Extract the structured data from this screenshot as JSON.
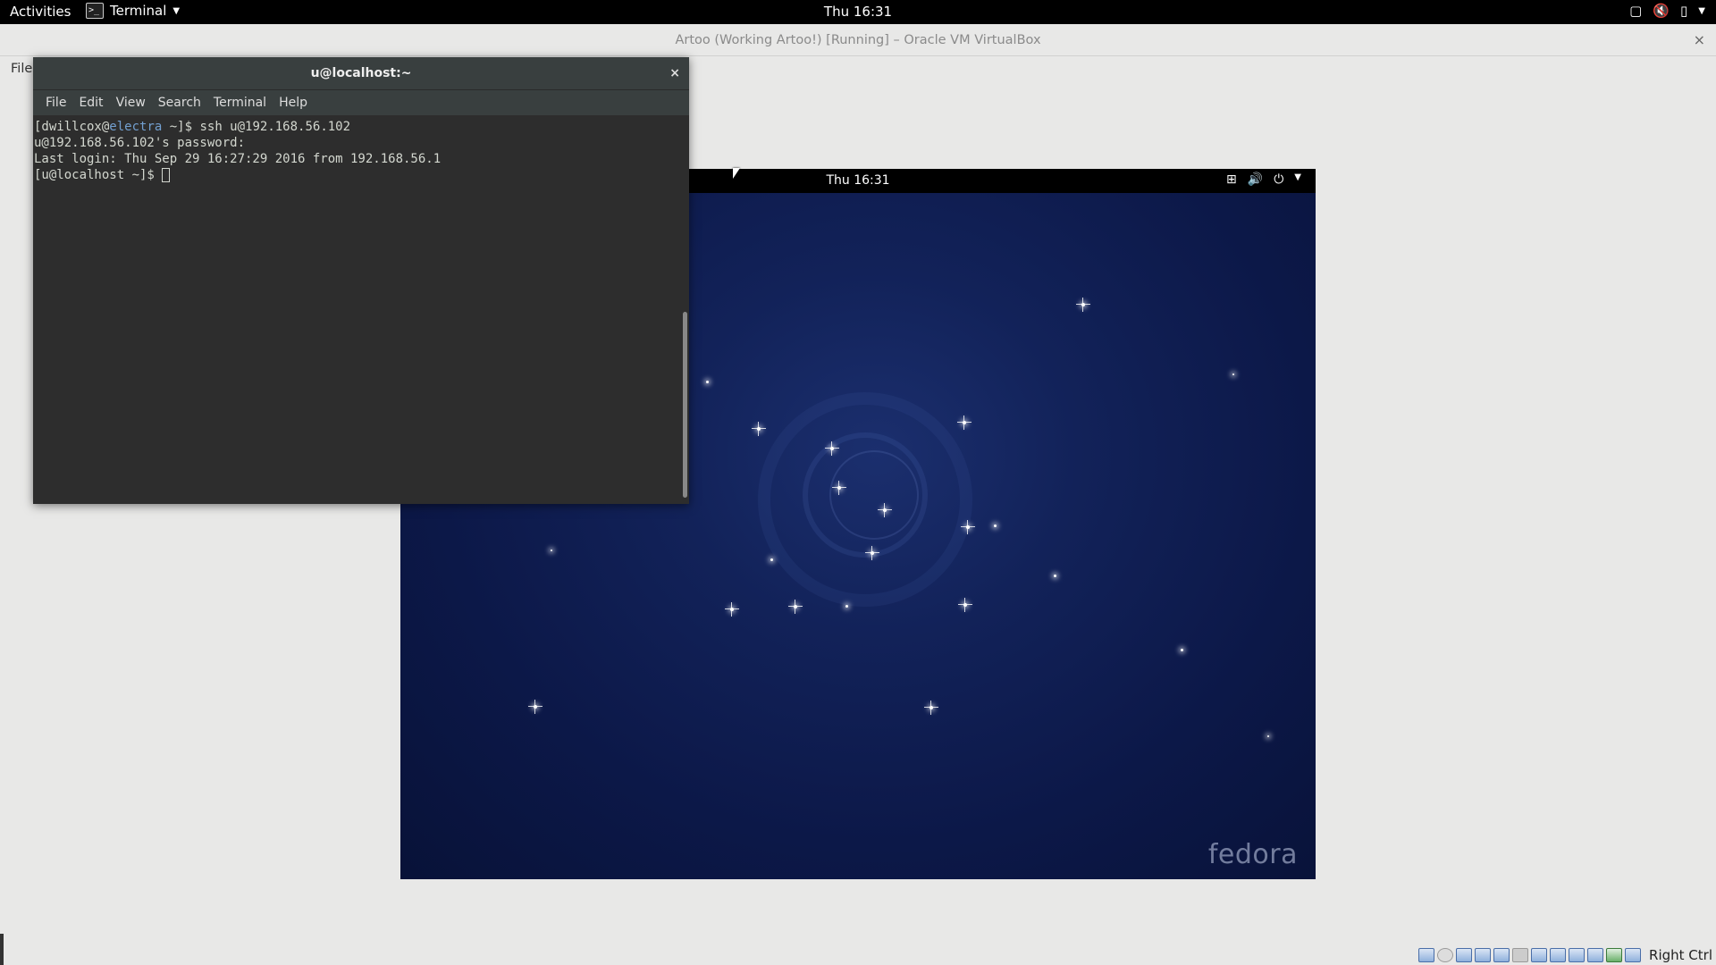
{
  "topbar": {
    "activities": "Activities",
    "app_name": "Terminal",
    "app_icon": ">_",
    "clock": "Thu 16:31",
    "tray_icons": [
      "window-icon",
      "mute-icon",
      "battery-icon",
      "chevron-down-icon"
    ]
  },
  "vbox": {
    "title": "Artoo (Working Artoo!) [Running] – Oracle VM VirtualBox",
    "close": "×",
    "menu_file": "File"
  },
  "guest": {
    "clock": "Thu 16:31",
    "tray_icons": [
      "network-icon",
      "volume-icon",
      "power-icon",
      "chevron-down-icon"
    ],
    "brand": "fedora"
  },
  "terminal": {
    "title": "u@localhost:~",
    "close": "×",
    "menu": [
      "File",
      "Edit",
      "View",
      "Search",
      "Terminal",
      "Help"
    ],
    "lines": {
      "l1_prefix": "[dwillcox@",
      "l1_host": "electra",
      "l1_suffix": " ~]$ ssh u@192.168.56.102",
      "l2": "u@192.168.56.102's password:",
      "l3": "Last login: Thu Sep 29 16:27:29 2016 from 192.168.56.1",
      "l4": "[u@localhost ~]$ "
    }
  },
  "statusbar": {
    "host_key": "Right Ctrl",
    "icons": [
      "hdd-icon",
      "optical-icon",
      "usb-icon",
      "shared-folder-icon",
      "pen-icon",
      "display-icon",
      "screen-icon",
      "network-icon",
      "video-capture-icon",
      "cpu-icon",
      "mouse-icon",
      "keyboard-icon"
    ]
  },
  "colors": {
    "topbar_bg": "#000000",
    "terminal_bg": "#2d2d2d",
    "terminal_host": "#729fcf",
    "vbox_bg": "#e8e8e7",
    "guest_bg": "#0c1848"
  }
}
